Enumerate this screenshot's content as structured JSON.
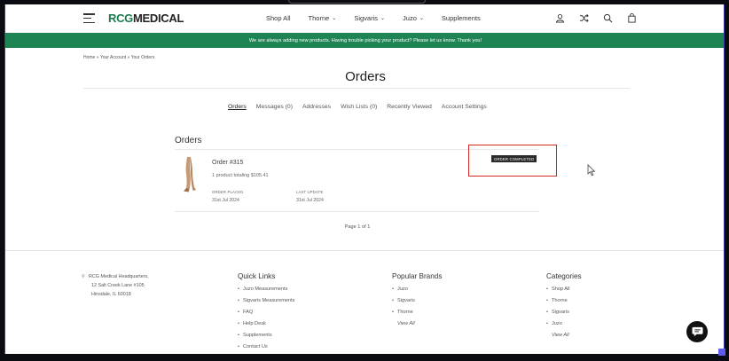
{
  "header": {
    "logo_brand": "RCG",
    "logo_suffix": "MEDICAL",
    "nav": [
      {
        "label": "Shop All",
        "has_dropdown": false
      },
      {
        "label": "Thorne",
        "has_dropdown": true
      },
      {
        "label": "Sigvaris",
        "has_dropdown": true
      },
      {
        "label": "Juzo",
        "has_dropdown": true
      },
      {
        "label": "Supplements",
        "has_dropdown": false
      }
    ],
    "icons": [
      "account-icon",
      "shuffle-icon",
      "search-icon",
      "bag-icon"
    ]
  },
  "banner": {
    "text": "We are always adding new products. Having trouble picking your product? Please let us know. Thank you!"
  },
  "breadcrumb": {
    "items": [
      "Home",
      "Your Account",
      "Your Orders"
    ],
    "separator": "»"
  },
  "page": {
    "title": "Orders"
  },
  "account_tabs": [
    {
      "label": "Orders",
      "active": true
    },
    {
      "label": "Messages (0)",
      "active": false
    },
    {
      "label": "Addresses",
      "active": false
    },
    {
      "label": "Wish Lists (0)",
      "active": false
    },
    {
      "label": "Recently Viewed",
      "active": false
    },
    {
      "label": "Account Settings",
      "active": false
    }
  ],
  "orders": {
    "heading": "Orders",
    "items": [
      {
        "number": "Order #315",
        "summary": "1 product totaling $105.41",
        "placed_label": "ORDER PLACED",
        "placed_date": "31st Jul 2024",
        "update_label": "LAST UPDATE",
        "update_date": "31st Jul 2024",
        "status": "ORDER COMPLETED"
      }
    ]
  },
  "pagination": {
    "text": "Page 1 of 1"
  },
  "footer": {
    "address": [
      "RCG Medical Headquarters,",
      "12 Salt Creek Lane #105",
      "Hinsdale, IL 60018"
    ],
    "quick_links": {
      "heading": "Quick Links",
      "items": [
        "Juzo Measurements",
        "Sigvaris Measurements",
        "FAQ",
        "Help Desk",
        "Supplements",
        "Contact Us"
      ]
    },
    "popular_brands": {
      "heading": "Popular Brands",
      "items": [
        "Juzo",
        "Sigvaris",
        "Thorne"
      ],
      "view_all": "View All"
    },
    "categories": {
      "heading": "Categories",
      "items": [
        "Shop All",
        "Thorne",
        "Sigvaris",
        "Juzo"
      ],
      "view_all": "View All"
    }
  },
  "colors": {
    "brand_green": "#1e8453",
    "highlight_red": "#d32626",
    "badge_dark": "#2b2b2b"
  }
}
